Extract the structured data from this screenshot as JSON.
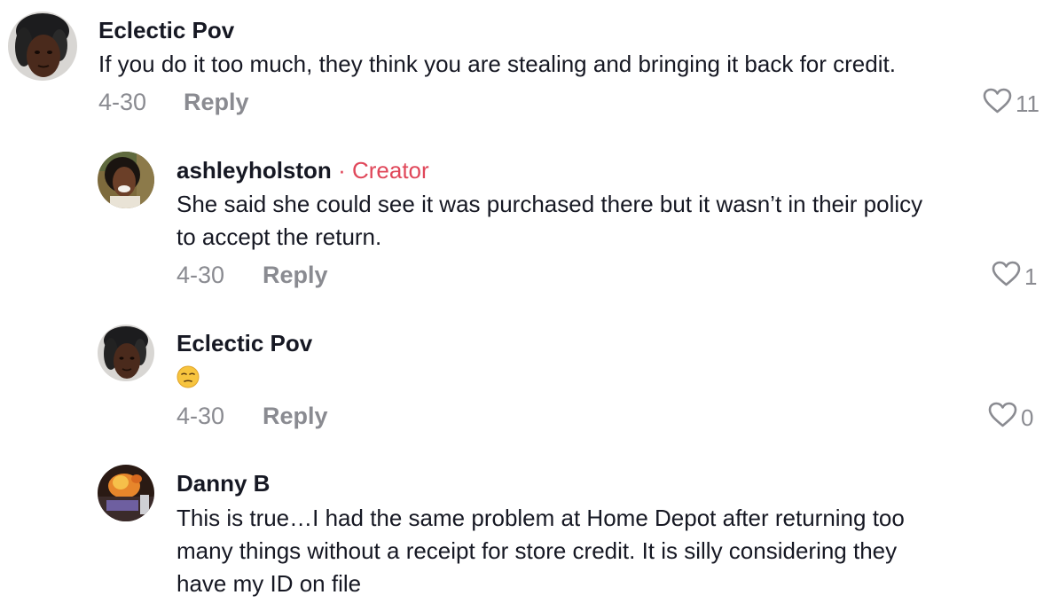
{
  "comments": [
    {
      "username": "Eclectic Pov",
      "text": "If you do it too much, they think you are stealing and bringing it back for credit.",
      "date": "4-30",
      "reply_label": "Reply",
      "likes": "11",
      "icon": "heart-outline-icon"
    },
    {
      "username": "ashleyholston",
      "creator_sep": "·",
      "creator_label": "Creator",
      "text_line1": "She said she could see it was purchased there but it wasn’t in their policy",
      "text_line2": "to accept the return.",
      "date": "4-30",
      "reply_label": "Reply",
      "likes": "1",
      "icon": "heart-outline-icon"
    },
    {
      "username": "Eclectic Pov",
      "emoji": "unamused-face-emoji",
      "date": "4-30",
      "reply_label": "Reply",
      "likes": "0",
      "icon": "heart-outline-icon"
    },
    {
      "username": "Danny B",
      "text_line1": "This is true…I had the same problem at Home Depot after returning too",
      "text_line2": "many things without a receipt for store credit. It is silly considering they",
      "text_line3": "have my ID on file"
    }
  ],
  "colors": {
    "text": "#161823",
    "muted": "#8a8b91",
    "creator": "#e0475a"
  }
}
